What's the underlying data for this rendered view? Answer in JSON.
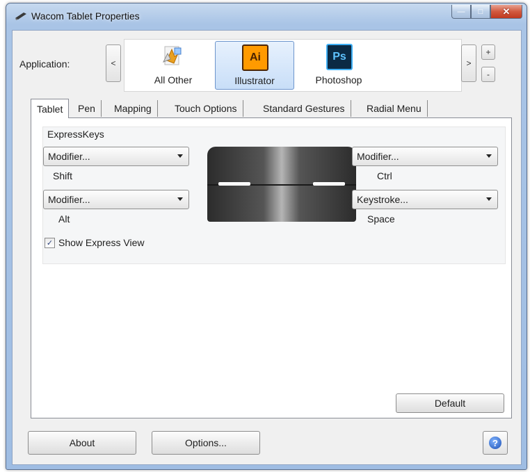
{
  "window": {
    "title": "Wacom Tablet Properties",
    "controls": {
      "minimize": "—",
      "maximize": "□",
      "close": "✕"
    }
  },
  "application": {
    "label": "Application:",
    "scroll_left": "<",
    "scroll_right": ">",
    "add": "+",
    "remove": "-",
    "items": [
      {
        "label": "All Other",
        "icon": "all-other-icon"
      },
      {
        "label": "Illustrator",
        "icon": "illustrator-icon",
        "badge": "Ai",
        "selected": true
      },
      {
        "label": "Photoshop",
        "icon": "photoshop-icon",
        "badge": "Ps"
      }
    ]
  },
  "tabs": [
    {
      "label": "Tablet",
      "active": true
    },
    {
      "label": "Pen"
    },
    {
      "label": "Mapping"
    },
    {
      "label": "Touch Options"
    },
    {
      "label": "Standard Gestures"
    },
    {
      "label": "Radial Menu"
    }
  ],
  "expresskeys": {
    "title": "ExpressKeys",
    "left_top": {
      "value": "Modifier...",
      "detail": "Shift"
    },
    "left_bottom": {
      "value": "Modifier...",
      "detail": "Alt"
    },
    "right_top": {
      "value": "Modifier...",
      "detail": "Ctrl"
    },
    "right_bottom": {
      "value": "Keystroke...",
      "detail": "Space"
    },
    "show_express_view": {
      "label": "Show Express View",
      "checked": true,
      "mark": "✓"
    }
  },
  "buttons": {
    "default": "Default",
    "about": "About",
    "options": "Options...",
    "help": "?"
  },
  "colors": {
    "illustrator": "#ff9a00",
    "photoshop": "#0b2a44",
    "selection": "#c8def8",
    "title_bar": "#a9c4e6"
  }
}
